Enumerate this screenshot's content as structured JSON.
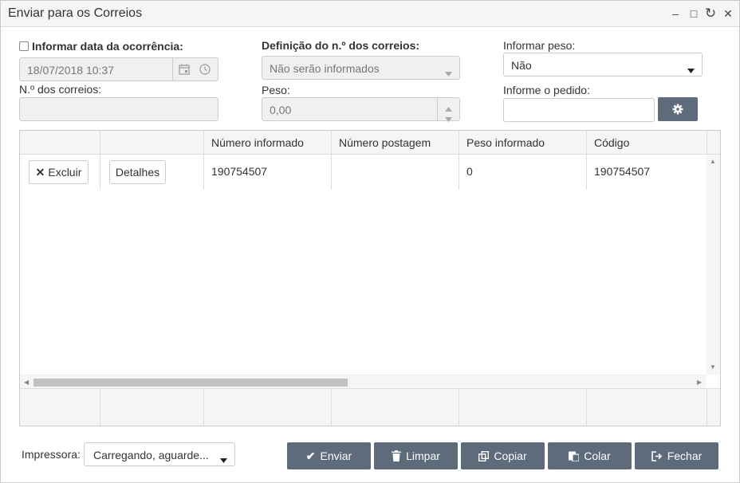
{
  "window": {
    "title": "Enviar para os Correios",
    "controls": {
      "minimize": "–",
      "maximize": "□",
      "refresh": "↻",
      "close": "✕"
    }
  },
  "form": {
    "occurrence_date": {
      "label": "Informar data da ocorrência:",
      "checked": false,
      "value": "18/07/2018 10:37"
    },
    "correios_definition": {
      "label": "Definição do n.º dos correios:",
      "value": "Não serão informados"
    },
    "weight_info": {
      "label": "Informar peso:",
      "value": "Não"
    },
    "correios_number": {
      "label": "N.º dos correios:",
      "value": ""
    },
    "weight": {
      "label": "Peso:",
      "value": "0,00"
    },
    "order": {
      "label": "Informe o pedido:",
      "value": ""
    }
  },
  "table": {
    "columns": [
      "",
      "",
      "Número informado",
      "Número postagem",
      "Peso informado",
      "Código"
    ],
    "rows": [
      {
        "delete_label": "Excluir",
        "details_label": "Detalhes",
        "numero_informado": "190754507",
        "numero_postagem": "",
        "peso_informado": "0",
        "codigo": "190754507"
      }
    ]
  },
  "footer": {
    "printer_label": "Impressora:",
    "printer_value": "Carregando, aguarde...",
    "buttons": {
      "send": "Enviar",
      "clear": "Limpar",
      "copy": "Copiar",
      "paste": "Colar",
      "close": "Fechar"
    }
  },
  "colors": {
    "button_bg": "#5d6b7a",
    "disabled_bg": "#f0f0f0",
    "header_bg": "#f5f5f5"
  }
}
